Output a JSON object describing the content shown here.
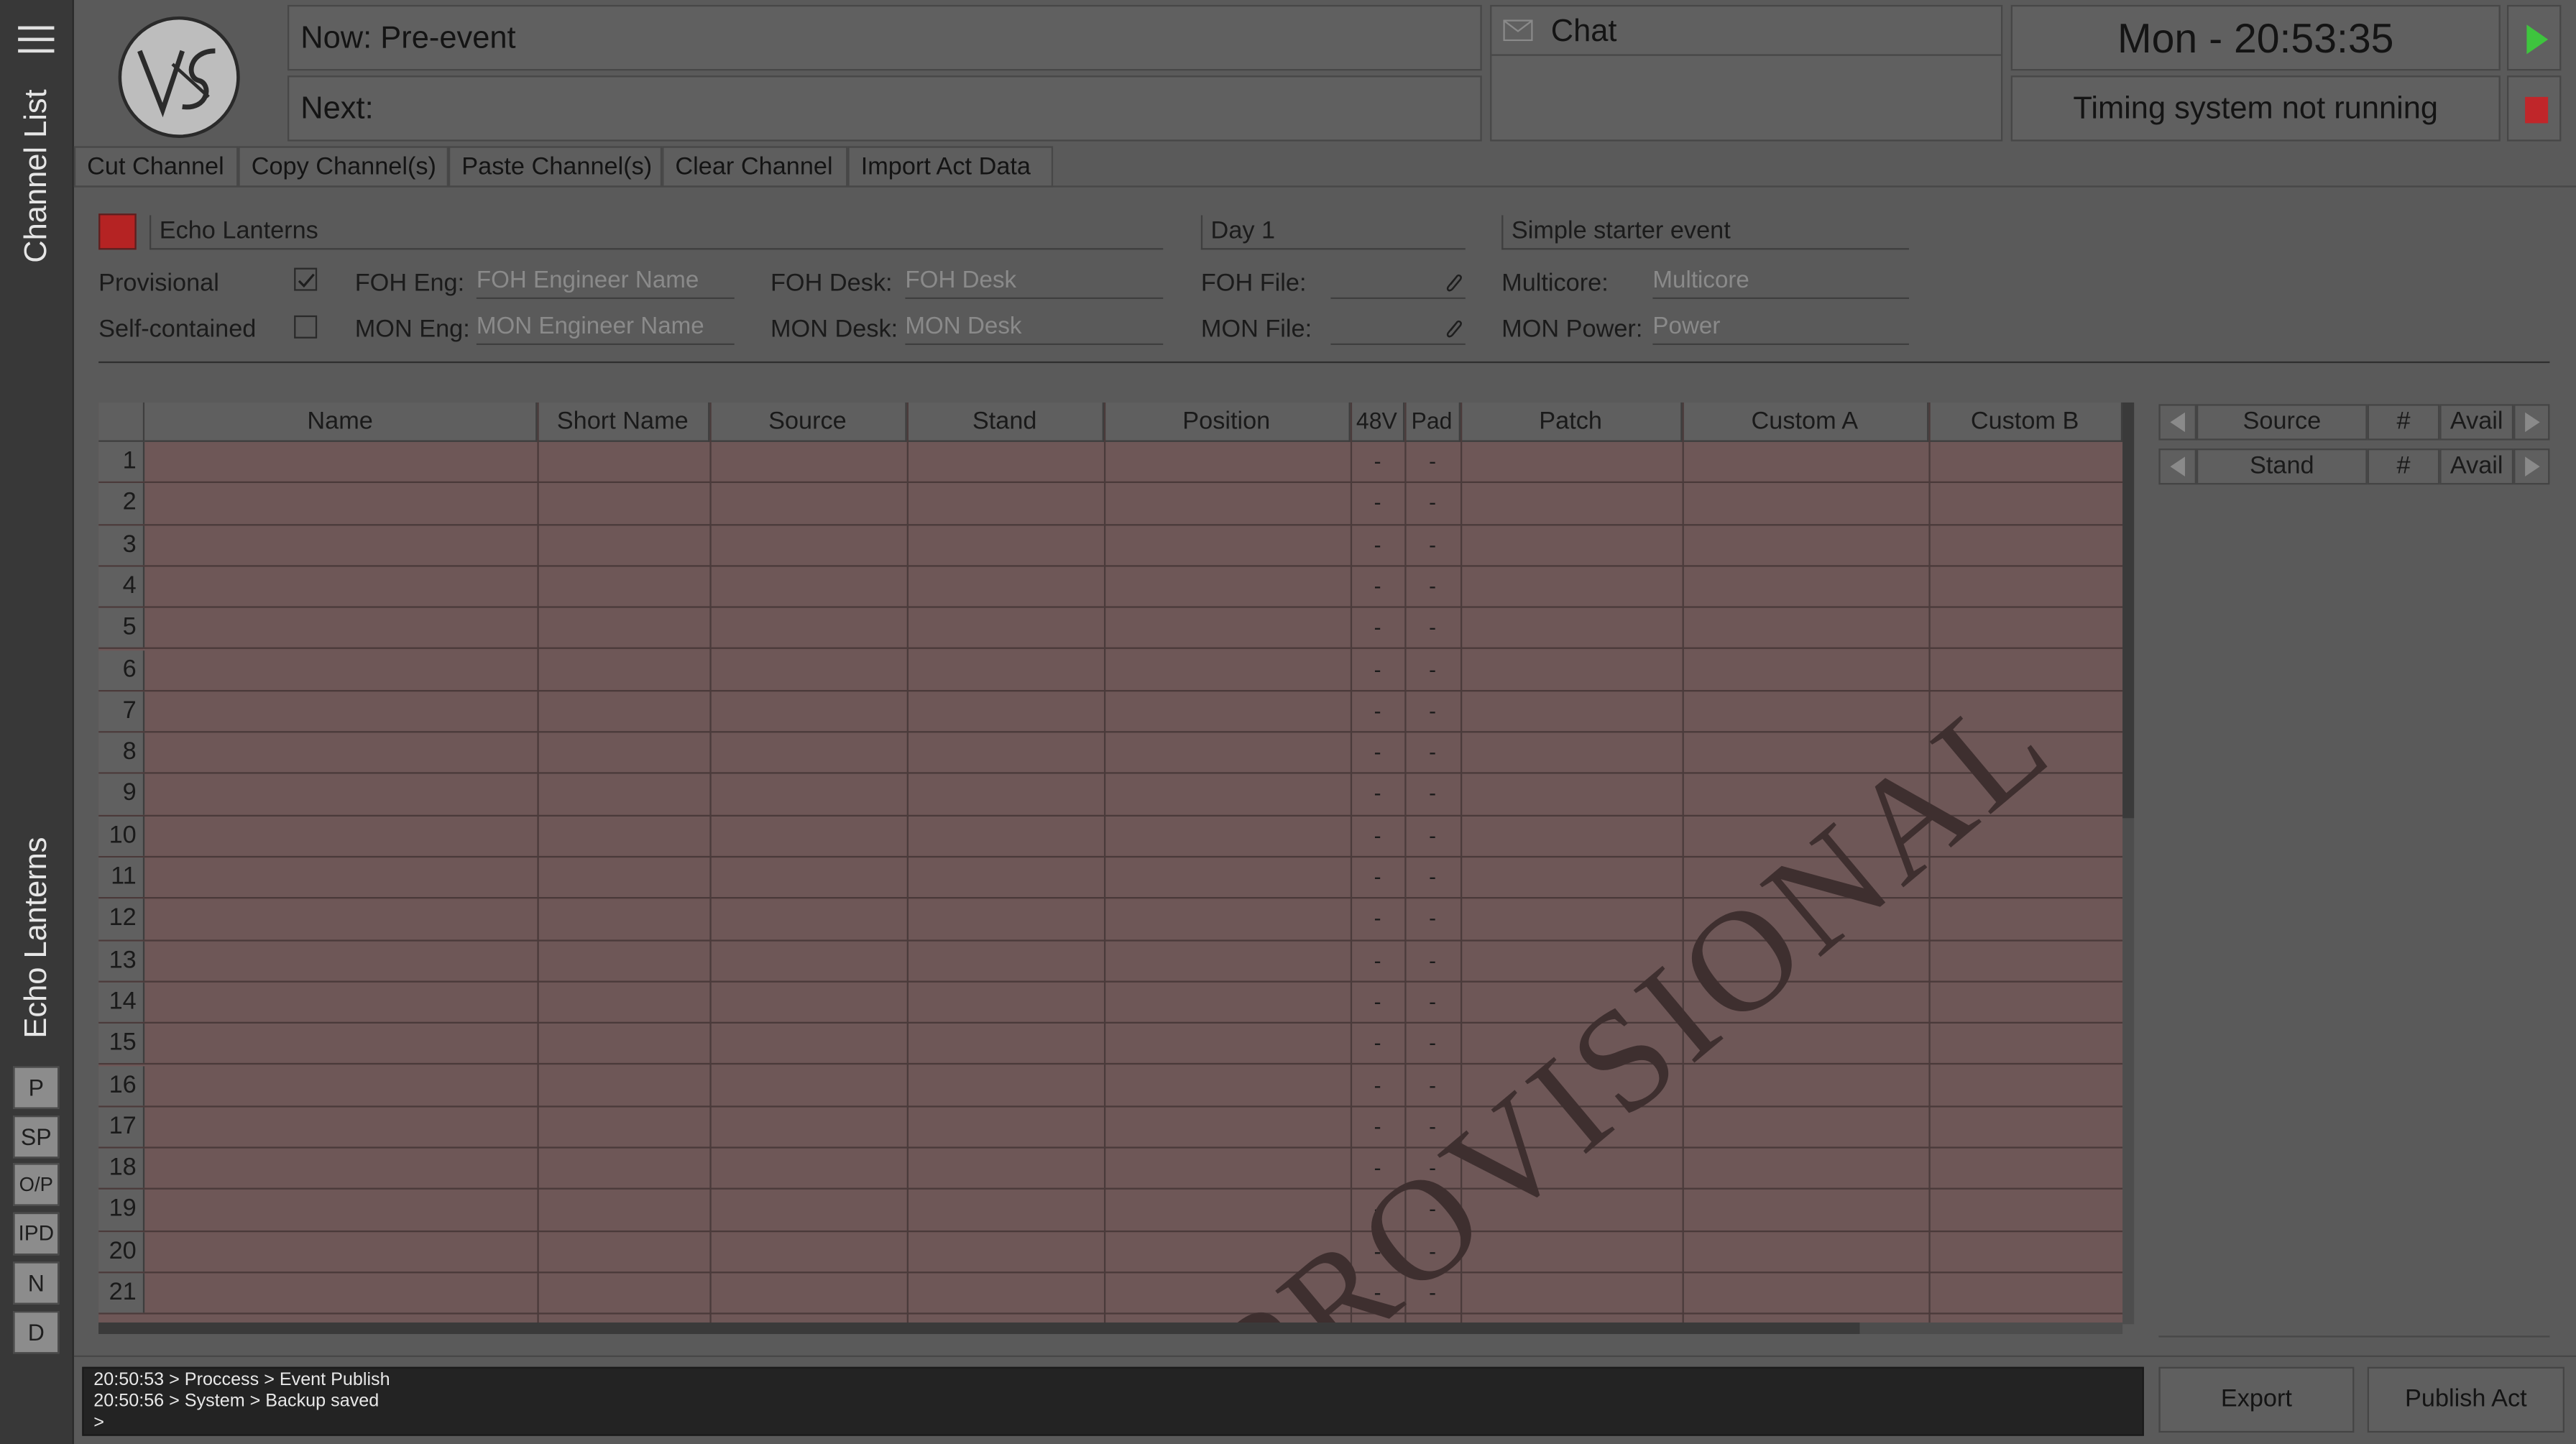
{
  "sidebar": {
    "title": "Channel List",
    "act": "Echo Lanterns",
    "buttons": [
      "P",
      "SP",
      "O/P",
      "IPD",
      "N",
      "D"
    ]
  },
  "header": {
    "now": "Now: Pre-event",
    "next": "Next:",
    "chat": "Chat",
    "clock": "Mon - 20:53:35",
    "timing": "Timing system not running",
    "colors": {
      "play": "#3ec43e",
      "stop": "#c0262a"
    }
  },
  "toolbar": [
    "Cut Channel",
    "Copy Channel(s)",
    "Paste Channel(s)",
    "Clear Channel",
    "Import Act Data"
  ],
  "act": {
    "color": "#b52323",
    "name": "Echo Lanterns",
    "day": "Day 1",
    "event": "Simple starter event",
    "provisional_label": "Provisional",
    "self_contained_label": "Self-contained",
    "foh_eng_label": "FOH Eng:",
    "foh_eng_placeholder": "FOH Engineer Name",
    "mon_eng_label": "MON Eng:",
    "mon_eng_placeholder": "MON Engineer Name",
    "foh_desk_label": "FOH Desk:",
    "foh_desk_placeholder": "FOH Desk",
    "mon_desk_label": "MON Desk:",
    "mon_desk_placeholder": "MON Desk",
    "foh_file_label": "FOH File:",
    "mon_file_label": "MON File:",
    "multicore_label": "Multicore:",
    "multicore_placeholder": "Multicore",
    "mon_power_label": "MON Power:",
    "mon_power_placeholder": "Power"
  },
  "table": {
    "columns": [
      "Name",
      "Short Name",
      "Source",
      "Stand",
      "Position",
      "48V",
      "Pad",
      "Patch",
      "Custom A",
      "Custom B"
    ],
    "rows": [
      "1",
      "2",
      "3",
      "4",
      "5",
      "6",
      "7",
      "8",
      "9",
      "10",
      "11",
      "12",
      "13",
      "14",
      "15",
      "16",
      "17",
      "18",
      "19",
      "20",
      "21"
    ],
    "empty": "-"
  },
  "watermark": "PROVISIONAL",
  "right_panel": {
    "source": "Source",
    "stand": "Stand",
    "hash": "#",
    "avail": "Avail"
  },
  "log": [
    "20:50:53 > Proccess > Event Publish",
    "20:50:56 > System > Backup saved",
    ">"
  ],
  "actions": {
    "export": "Export",
    "publish": "Publish Act"
  }
}
